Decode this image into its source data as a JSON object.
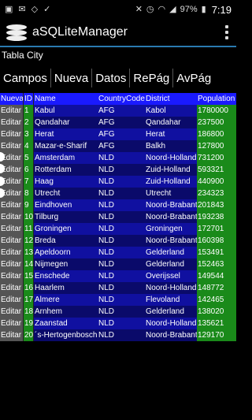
{
  "status": {
    "battery": "97%",
    "time": "7:19",
    "left_icons": [
      "photo-icon",
      "gmail-icon",
      "sync-icon",
      "check-icon"
    ],
    "right_icons": [
      "mute-icon",
      "alarm-icon",
      "wifi-icon",
      "signal-icon",
      "battery-icon"
    ]
  },
  "app": {
    "title": "aSQLiteManager"
  },
  "table_title": "Tabla City",
  "toolbar": {
    "buttons": [
      "Campos",
      "Nueva",
      "Datos",
      "RePág",
      "AvPág"
    ]
  },
  "grid": {
    "headers": [
      "Nueva",
      "ID",
      "Name",
      "CountryCode",
      "District",
      "Population"
    ],
    "edit_label": "Editar",
    "rows": [
      [
        "1",
        "Kabul",
        "AFG",
        "Kabol",
        "1780000"
      ],
      [
        "2",
        "Qandahar",
        "AFG",
        "Qandahar",
        "237500"
      ],
      [
        "3",
        "Herat",
        "AFG",
        "Herat",
        "186800"
      ],
      [
        "4",
        "Mazar-e-Sharif",
        "AFG",
        "Balkh",
        "127800"
      ],
      [
        "5",
        "Amsterdam",
        "NLD",
        "Noord-Holland",
        "731200"
      ],
      [
        "6",
        "Rotterdam",
        "NLD",
        "Zuid-Holland",
        "593321"
      ],
      [
        "7",
        "Haag",
        "NLD",
        "Zuid-Holland",
        "440900"
      ],
      [
        "8",
        "Utrecht",
        "NLD",
        "Utrecht",
        "234323"
      ],
      [
        "9",
        "Eindhoven",
        "NLD",
        "Noord-Brabant",
        "201843"
      ],
      [
        "10",
        "Tilburg",
        "NLD",
        "Noord-Brabant",
        "193238"
      ],
      [
        "11",
        "Groningen",
        "NLD",
        "Groningen",
        "172701"
      ],
      [
        "12",
        "Breda",
        "NLD",
        "Noord-Brabant",
        "160398"
      ],
      [
        "13",
        "Apeldoorn",
        "NLD",
        "Gelderland",
        "153491"
      ],
      [
        "14",
        "Nijmegen",
        "NLD",
        "Gelderland",
        "152463"
      ],
      [
        "15",
        "Enschede",
        "NLD",
        "Overijssel",
        "149544"
      ],
      [
        "16",
        "Haarlem",
        "NLD",
        "Noord-Holland",
        "148772"
      ],
      [
        "17",
        "Almere",
        "NLD",
        "Flevoland",
        "142465"
      ],
      [
        "18",
        "Arnhem",
        "NLD",
        "Gelderland",
        "138020"
      ],
      [
        "19",
        "Zaanstad",
        "NLD",
        "Noord-Holland",
        "135621"
      ],
      [
        "20",
        "´s-Hertogenbosch",
        "NLD",
        "Noord-Brabant",
        "129170"
      ]
    ]
  },
  "colors": {
    "header_blue": "#1a1aff",
    "row_blue_light": "#1010a0",
    "row_blue_dark": "#0a0a6a",
    "green": "#1a8a1a",
    "edit_gray": "#555555",
    "accent_line": "#2a7ab0"
  }
}
